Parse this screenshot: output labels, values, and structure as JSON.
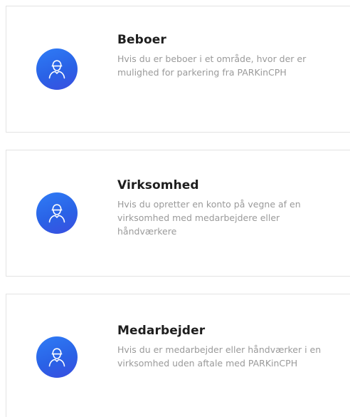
{
  "options": [
    {
      "icon": "user-icon",
      "title": "Beboer",
      "description": "Hvis du er beboer i et område, hvor der er mulighed for parkering fra PARKinCPH"
    },
    {
      "icon": "user-icon",
      "title": "Virksomhed",
      "description": "Hvis du opretter en konto på vegne af en virksomhed med medarbejdere eller håndværkere"
    },
    {
      "icon": "user-icon",
      "title": "Medarbejder",
      "description": "Hvis du er medarbejder eller håndværker i en virksomhed uden aftale med PARKinCPH"
    }
  ],
  "colors": {
    "accent": "#2a62e6",
    "title": "#1e1e1e",
    "description": "#9a9a9a",
    "border": "#e3e3e3"
  }
}
